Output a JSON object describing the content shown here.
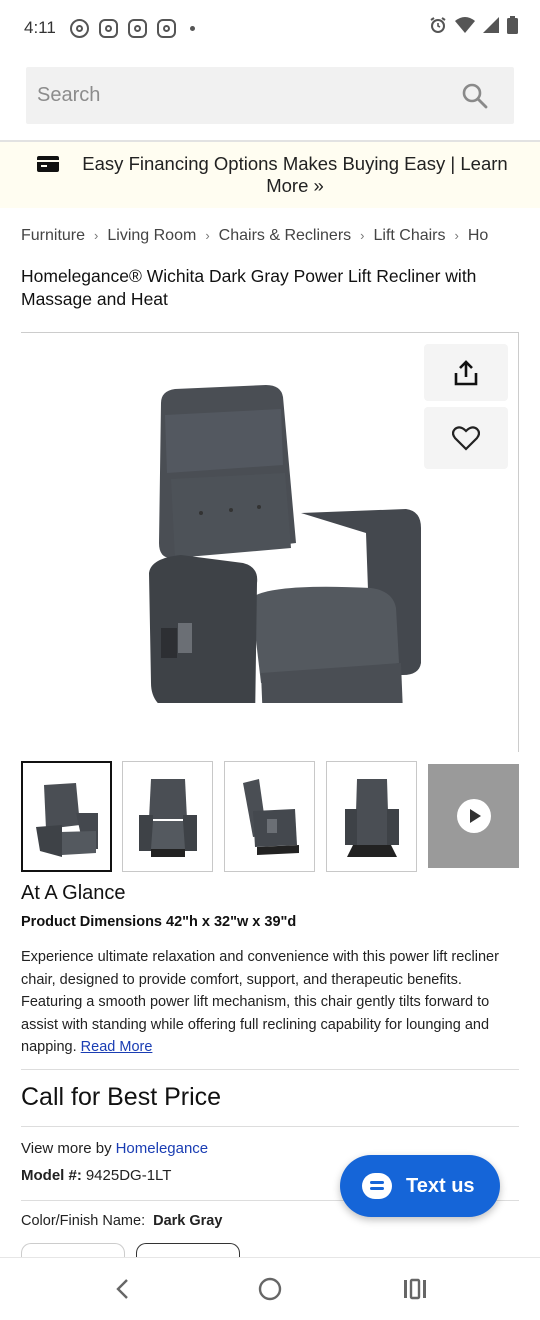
{
  "status_bar": {
    "time": "4:11",
    "icons": [
      "threads-icon",
      "instagram-icon",
      "instagram-icon",
      "instagram-icon",
      "notification-dot"
    ],
    "right_icons": [
      "alarm-icon",
      "wifi-icon",
      "signal-icon",
      "battery-icon"
    ]
  },
  "search": {
    "placeholder": "Search"
  },
  "promo": {
    "text": "Easy Financing Options Makes Buying Easy | Learn More »"
  },
  "breadcrumb": [
    "Furniture",
    "Living Room",
    "Chairs & Recliners",
    "Lift Chairs",
    "Ho"
  ],
  "product": {
    "title": "Homelegance® Wichita Dark Gray Power Lift Recliner with Massage and Heat",
    "glance_heading": "At A Glance",
    "dimensions_label": "Product Dimensions",
    "dimensions_value": "42\"h x 32\"w x 39\"d",
    "description": "Experience ultimate relaxation and convenience with this power lift recliner chair, designed to provide comfort, support, and therapeutic benefits. Featuring a smooth power lift mechanism, this chair gently tilts forward to assist with standing while offering full reclining capability for lounging and napping.",
    "read_more": "Read More",
    "price": "Call for Best Price",
    "view_more_label": "View more by",
    "brand": "Homelegance",
    "model_label": "Model #:",
    "model_value": "9425DG-1LT",
    "color_label": "Color/Finish Name:",
    "color_value": "Dark Gray"
  },
  "chat": {
    "label": "Text us"
  },
  "colors": {
    "chat_blue": "#1565d8",
    "link_blue": "#1a3db3",
    "promo_bg": "#fffdf1",
    "chair_gray": "#4a4e54"
  }
}
